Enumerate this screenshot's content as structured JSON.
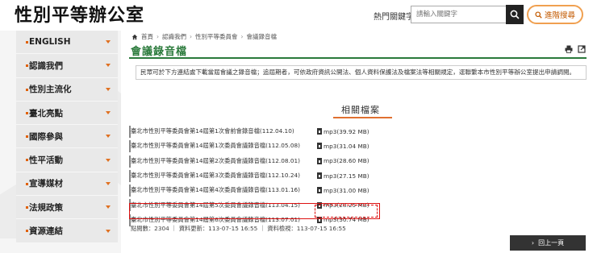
{
  "header": {
    "logo": "性別平等辦公室",
    "keyword_label": "熱門關鍵字",
    "search_placeholder": "請輸入關鍵字",
    "advanced_search": "進階搜尋"
  },
  "sidebar": {
    "items": [
      {
        "label": "ENGLISH"
      },
      {
        "label": "認識我們"
      },
      {
        "label": "性別主流化"
      },
      {
        "label": "臺北亮點"
      },
      {
        "label": "國際參與"
      },
      {
        "label": "性平活動"
      },
      {
        "label": "宣導媒材"
      },
      {
        "label": "法規政策"
      },
      {
        "label": "資源連結"
      }
    ]
  },
  "breadcrumb": [
    "首頁",
    "認識我們",
    "性別平等委員會",
    "會議錄音檔"
  ],
  "page_title": "會議錄音檔",
  "notice": "民眾可於下方連結處下載當屆會議之錄音檔；追屆期者，可依政府資訊公開法、個人資料保護法及檔案法等相關規定，逕聯繫本市性別平等辦公室提出申請調閱。",
  "related_heading": "相關檔案",
  "files": [
    {
      "name": "臺北市性別平等委員會第14屆第1次會前會錄音檔(112.04.10)",
      "file": "mp3(39.92 MB)"
    },
    {
      "name": "臺北市性別平等委員會第14屆第1次委員會議錄音檔(112.05.08)",
      "file": "mp3(31.04 MB)"
    },
    {
      "name": "臺北市性別平等委員會第14屆第2次委員會議錄音檔(112.08.01)",
      "file": "mp3(28.60 MB)"
    },
    {
      "name": "臺北市性別平等委員會第14屆第3次委員會議錄音檔(112.10.24)",
      "file": "mp3(27.15 MB)"
    },
    {
      "name": "臺北市性別平等委員會第14屆第4次委員會議錄音檔(113.01.16)",
      "file": "mp3(31.00 MB)"
    },
    {
      "name": "臺北市性別平等委員會第14屆第5次委員會議錄音檔(113.04.15)",
      "file": "mp3(28.25 MB)"
    },
    {
      "name": "臺北市性別平等委員會第14屆第6次委員會議錄音檔(113.07.01)",
      "file": "mp3(30.74 MB)"
    }
  ],
  "meta": {
    "text": "點閱數：2304 ｜ 資料更新：113-07-15 16:55 ｜ 資料檢視：113-07-15 16:55"
  },
  "back_button": "回上一頁",
  "colors": {
    "accent_green": "#2a7a3b",
    "accent_orange": "#e07030",
    "highlight_red": "#d11111"
  }
}
